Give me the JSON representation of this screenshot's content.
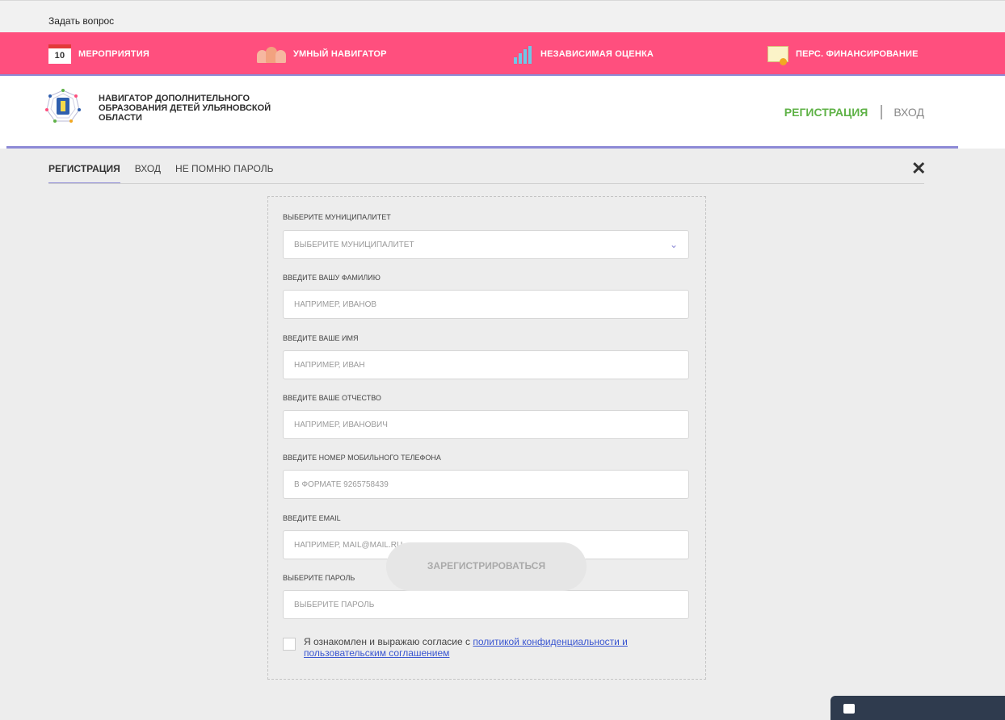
{
  "topbar": {
    "ask_link": "Задать вопрос"
  },
  "nav": {
    "items": [
      {
        "label": "МЕРОПРИЯТИЯ",
        "icon": "calendar-icon",
        "icon_text": "10"
      },
      {
        "label": "УМНЫЙ НАВИГАТОР",
        "icon": "people-icon"
      },
      {
        "label": "НЕЗАВИСИМАЯ ОЦЕНКА",
        "icon": "stats-icon"
      },
      {
        "label": "ПЕРС. ФИНАНСИРОВАНИЕ",
        "icon": "certificate-icon"
      }
    ]
  },
  "header": {
    "brand": "НАВИГАТОР ДОПОЛНИТЕЛЬНОГО ОБРАЗОВАНИЯ ДЕТЕЙ УЛЬЯНОВСКОЙ ОБЛАСТИ",
    "register": "РЕГИСТРАЦИЯ",
    "login": "ВХОД"
  },
  "tabs": [
    "РЕГИСТРАЦИЯ",
    "ВХОД",
    "НЕ ПОМНЮ ПАРОЛЬ"
  ],
  "form": {
    "municipality_label": "ВЫБЕРИТЕ МУНИЦИПАЛИТЕТ",
    "municipality_value": "ВЫБЕРИТЕ МУНИЦИПАЛИТЕТ",
    "surname_label": "ВВЕДИТЕ ВАШУ ФАМИЛИЮ",
    "surname_placeholder": "НАПРИМЕР, ИВАНОВ",
    "name_label": "ВВЕДИТЕ ВАШЕ ИМЯ",
    "name_placeholder": "НАПРИМЕР, ИВАН",
    "patronymic_label": "ВВЕДИТЕ ВАШЕ ОТЧЕСТВО",
    "patronymic_placeholder": "НАПРИМЕР, ИВАНОВИЧ",
    "phone_label": "ВВЕДИТЕ НОМЕР МОБИЛЬНОГО ТЕЛЕФОНА",
    "phone_placeholder": "В ФОРМАТЕ 9265758439",
    "email_label": "ВВЕДИТЕ EMAIL",
    "email_placeholder": "НАПРИМЕР, MAIL@MAIL.RU",
    "password_label": "ВЫБЕРИТЕ ПАРОЛЬ",
    "password_placeholder": "ВЫБЕРИТЕ ПАРОЛЬ",
    "agree_text": "Я ознакомлен и выражаю согласие с ",
    "agree_link": "политикой конфиденциальности и пользовательским соглашением",
    "submit": "ЗАРЕГИСТРИРОВАТЬСЯ"
  },
  "colors": {
    "accent_pink": "#ff4f7e",
    "accent_purple": "#8d8ad6",
    "accent_green": "#5fb247",
    "link_blue": "#3a56d1"
  }
}
